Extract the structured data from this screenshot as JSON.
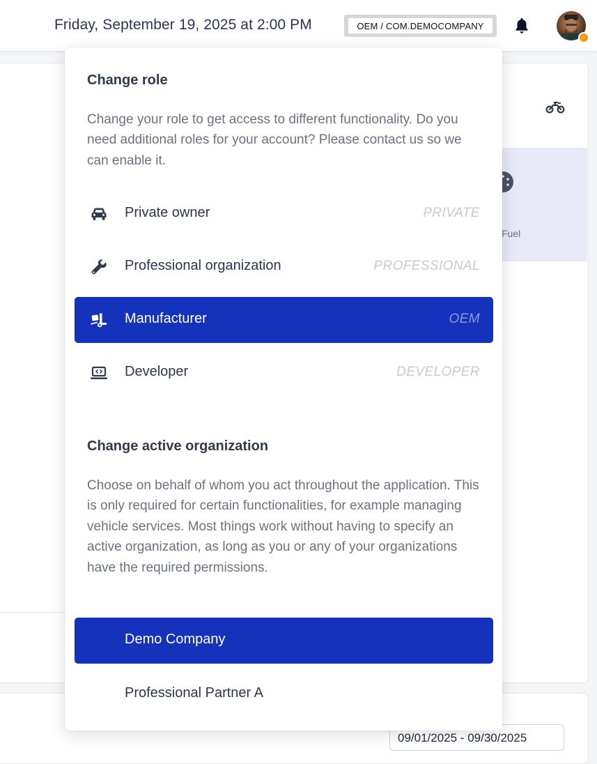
{
  "header": {
    "datetime": "Friday, September 19, 2025 at 2:00 PM",
    "role_badge": "OEM / COM.DEMOCOMPANY",
    "bell_icon": "bell-icon",
    "avatar_icon": "user-avatar",
    "status_color": "#f39a1f"
  },
  "background": {
    "fuel_label": "Fuel",
    "tick": "/",
    "date_range": "09/01/2025 - 09/30/2025"
  },
  "role_section": {
    "title": "Change role",
    "description": "Change your role to get access to different functionality. Do you need additional roles for your account? Please contact us so we can enable it.",
    "items": [
      {
        "label": "Private owner",
        "code": "PRIVATE",
        "icon": "car-icon",
        "active": false
      },
      {
        "label": "Professional organization",
        "code": "PROFESSIONAL",
        "icon": "wrench-icon",
        "active": false
      },
      {
        "label": "Manufacturer",
        "code": "OEM",
        "icon": "truck-loading-icon",
        "active": true
      },
      {
        "label": "Developer",
        "code": "DEVELOPER",
        "icon": "laptop-code-icon",
        "active": false
      }
    ]
  },
  "org_section": {
    "title": "Change active organization",
    "description": "Choose on behalf of whom you act throughout the application. This is only required for certain functionalities, for example managing vehicle services. Most things work without having to specify an active organization, as long as you or any of your organizations have the required permissions.",
    "items": [
      {
        "label": "Demo Company",
        "active": true
      },
      {
        "label": "Professional Partner A",
        "active": false
      }
    ]
  },
  "colors": {
    "accent": "#1532bc",
    "active_code": "#8a99dd",
    "inactive_code": "#c7cbd3"
  }
}
